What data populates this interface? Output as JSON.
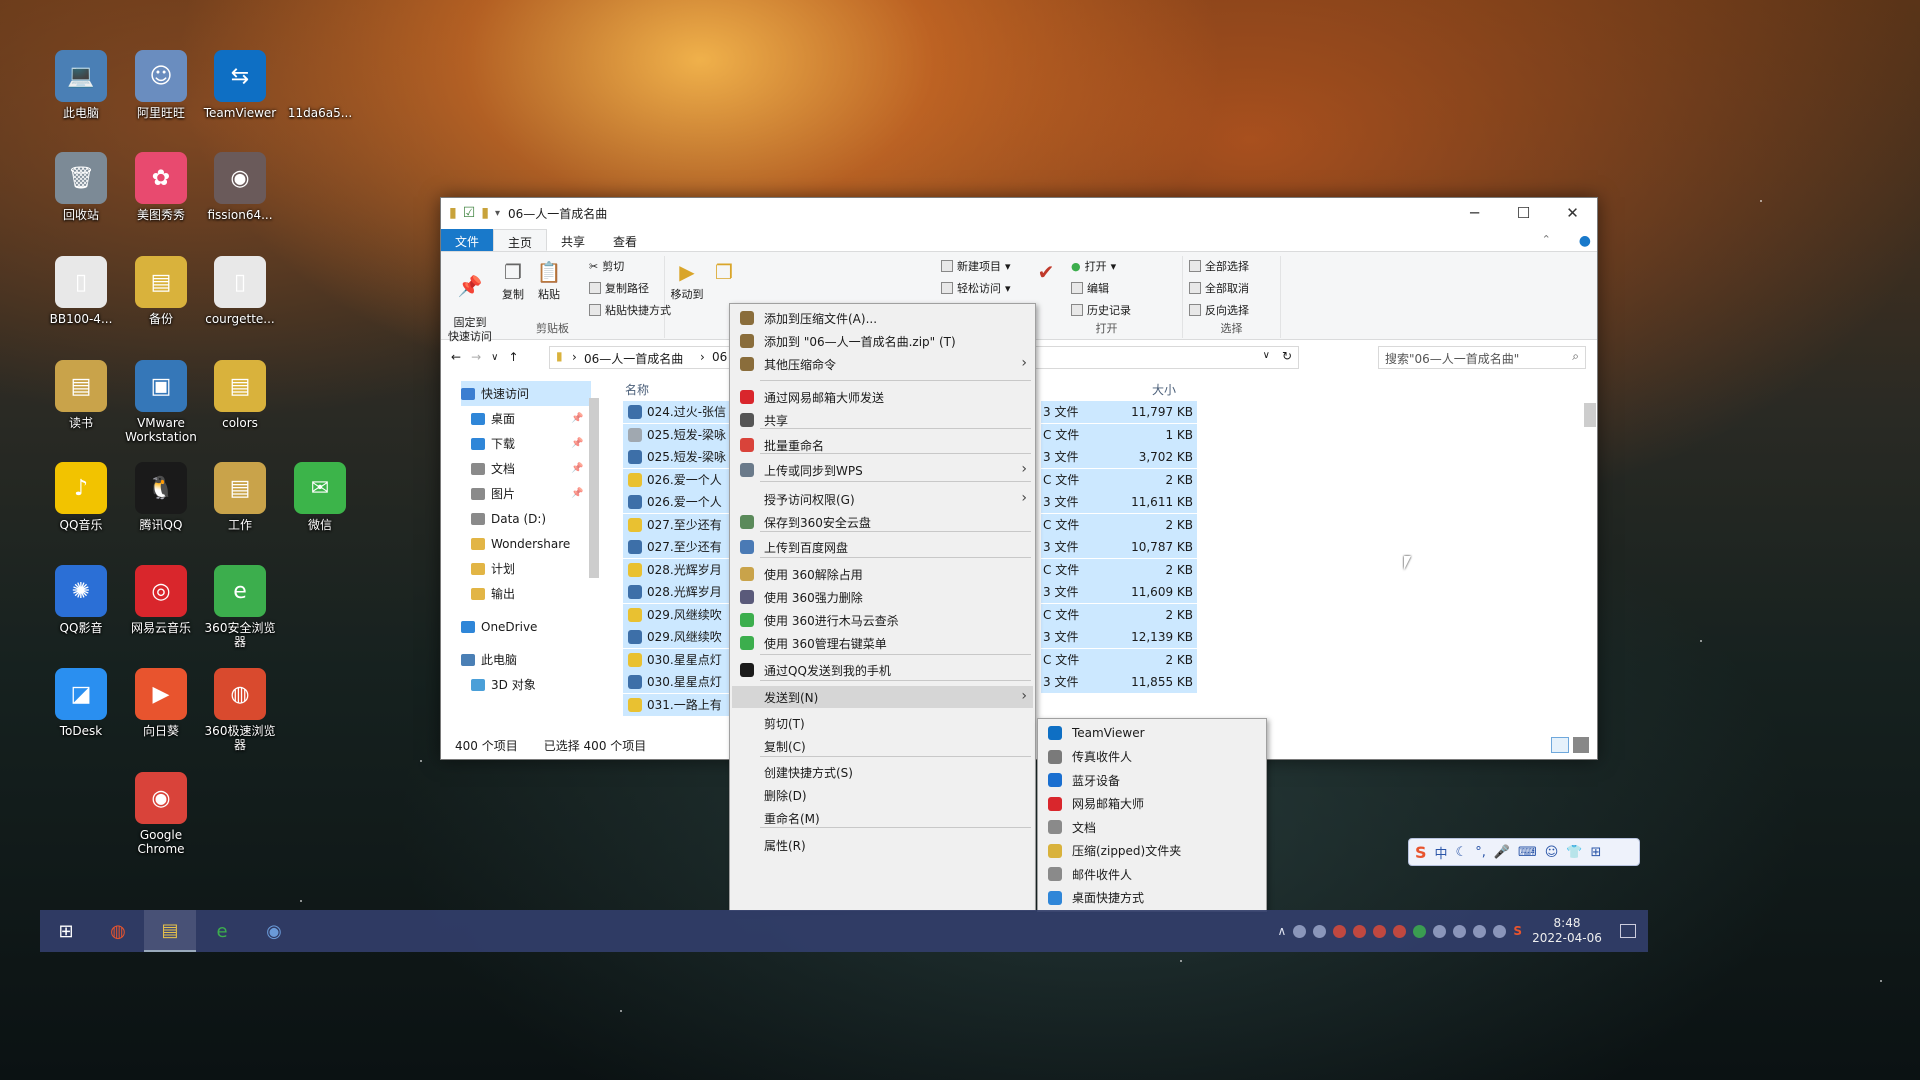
{
  "desktop": {
    "icons": [
      {
        "label": "此电脑",
        "glyph": "💻",
        "color": "#4a7fb5"
      },
      {
        "label": "阿里旺旺",
        "glyph": "☺",
        "color": "#6a8dbf"
      },
      {
        "label": "TeamViewer",
        "glyph": "⇆",
        "color": "#0e6fc4"
      },
      {
        "label": "11da6a5...",
        "glyph": "",
        "color": "transparent"
      },
      {
        "label": "回收站",
        "glyph": "🗑",
        "color": "#7c8a96"
      },
      {
        "label": "美图秀秀",
        "glyph": "✿",
        "color": "#e84a6f"
      },
      {
        "label": "fission64...",
        "glyph": "◉",
        "color": "#6a5a5a"
      },
      {
        "label": "BB100-4...",
        "glyph": "▯",
        "color": "#e8e8e8"
      },
      {
        "label": "备份",
        "glyph": "▤",
        "color": "#d9b23c"
      },
      {
        "label": "courgette...",
        "glyph": "▯",
        "color": "#e8e8e8"
      },
      {
        "label": "读书",
        "glyph": "▤",
        "color": "#c9a34a"
      },
      {
        "label": "VMware Workstation",
        "glyph": "▣",
        "color": "#3577b8"
      },
      {
        "label": "colors",
        "glyph": "▤",
        "color": "#d9b23c"
      },
      {
        "label": "QQ音乐",
        "glyph": "♪",
        "color": "#f2c300"
      },
      {
        "label": "腾讯QQ",
        "glyph": "🐧",
        "color": "#1a1a1a"
      },
      {
        "label": "工作",
        "glyph": "▤",
        "color": "#c9a34a"
      },
      {
        "label": "微信",
        "glyph": "✉",
        "color": "#3cb44a"
      },
      {
        "label": "QQ影音",
        "glyph": "✺",
        "color": "#2b6fd6"
      },
      {
        "label": "网易云音乐",
        "glyph": "◎",
        "color": "#d9262c"
      },
      {
        "label": "360安全浏览器",
        "glyph": "e",
        "color": "#3cae4d"
      },
      {
        "label": "ToDesk",
        "glyph": "◪",
        "color": "#2a8ff0"
      },
      {
        "label": "向日葵",
        "glyph": "▶",
        "color": "#e8542e"
      },
      {
        "label": "360极速浏览器",
        "glyph": "◍",
        "color": "#d94a2e"
      },
      {
        "label": "Google Chrome",
        "glyph": "◉",
        "color": "#d9433a"
      }
    ]
  },
  "explorer": {
    "title": "06—人一首成名曲",
    "tabs": [
      "文件",
      "主页",
      "共享",
      "查看"
    ],
    "ribbon": {
      "pin_label": "固定到\n快速访问",
      "copy_label": "复制",
      "paste_label": "粘贴",
      "cut_label": "剪切",
      "copy_path_label": "复制路径",
      "paste_shortcut_label": "粘贴快捷方式",
      "clipboard_group": "剪贴板",
      "move_label": "移动到",
      "new_item_label": "新建项目",
      "easy_access_label": "轻松访问",
      "open_label": "打开",
      "edit_label": "编辑",
      "history_label": "历史记录",
      "open_group": "打开",
      "select_all_label": "全部选择",
      "select_none_label": "全部取消",
      "invert_label": "反向选择",
      "select_group": "选择"
    },
    "address": {
      "path_root": "06—人一首成名曲",
      "path_next": "06",
      "search_placeholder": "搜索\"06—人一首成名曲\""
    },
    "nav": [
      {
        "label": "快速访问",
        "color": "#3b7ed1"
      },
      {
        "label": "桌面",
        "color": "#2f86d8"
      },
      {
        "label": "下载",
        "color": "#2f86d8"
      },
      {
        "label": "文档",
        "color": "#8a8a8a"
      },
      {
        "label": "图片",
        "color": "#8a8a8a"
      },
      {
        "label": "Data (D:)",
        "color": "#8a8a8a"
      },
      {
        "label": "Wondershare",
        "color": "#e2b545"
      },
      {
        "label": "计划",
        "color": "#e2b545"
      },
      {
        "label": "输出",
        "color": "#e2b545"
      },
      {
        "label": "OneDrive",
        "color": "#2f86d8"
      },
      {
        "label": "此电脑",
        "color": "#4a7fb5"
      },
      {
        "label": "3D 对象",
        "color": "#4a9fd8"
      }
    ],
    "columns": {
      "name": "名称",
      "size": "大小"
    },
    "files": [
      {
        "name": "024.过火-张信",
        "type": "3 文件",
        "size": "11,797 KB",
        "color": "#3d6fa8"
      },
      {
        "name": "025.短发-梁咏",
        "type": "C 文件",
        "size": "1 KB",
        "color": "#a0a8b0"
      },
      {
        "name": "025.短发-梁咏",
        "type": "3 文件",
        "size": "3,702 KB",
        "color": "#3d6fa8"
      },
      {
        "name": "026.爱一个人",
        "type": "C 文件",
        "size": "2 KB",
        "color": "#e9c131"
      },
      {
        "name": "026.爱一个人",
        "type": "3 文件",
        "size": "11,611 KB",
        "color": "#3d6fa8"
      },
      {
        "name": "027.至少还有",
        "type": "C 文件",
        "size": "2 KB",
        "color": "#e9c131"
      },
      {
        "name": "027.至少还有",
        "type": "3 文件",
        "size": "10,787 KB",
        "color": "#3d6fa8"
      },
      {
        "name": "028.光辉岁月",
        "type": "C 文件",
        "size": "2 KB",
        "color": "#e9c131"
      },
      {
        "name": "028.光辉岁月",
        "type": "3 文件",
        "size": "11,609 KB",
        "color": "#3d6fa8"
      },
      {
        "name": "029.风继续吹",
        "type": "C 文件",
        "size": "2 KB",
        "color": "#e9c131"
      },
      {
        "name": "029.风继续吹",
        "type": "3 文件",
        "size": "12,139 KB",
        "color": "#3d6fa8"
      },
      {
        "name": "030.星星点灯",
        "type": "C 文件",
        "size": "2 KB",
        "color": "#e9c131"
      },
      {
        "name": "030.星星点灯",
        "type": "3 文件",
        "size": "11,855 KB",
        "color": "#3d6fa8"
      },
      {
        "name": "031.一路上有",
        "type": "",
        "size": "",
        "color": "#e9c131"
      }
    ],
    "status_count": "400 个项目",
    "status_selected": "已选择 400 个项目"
  },
  "context_menu": {
    "items": [
      {
        "label": "添加到压缩文件(A)...",
        "color": "#8a6d3b",
        "sub": false
      },
      {
        "label": "添加到 \"06—人一首成名曲.zip\" (T)",
        "color": "#8a6d3b",
        "sub": false
      },
      {
        "label": "其他压缩命令",
        "color": "#8a6d3b",
        "sub": true
      },
      {
        "label": "通过网易邮箱大师发送",
        "color": "#d9262c",
        "sub": false
      },
      {
        "label": "共享",
        "color": "#555555",
        "sub": false
      },
      {
        "label": "批量重命名",
        "color": "#d9433a",
        "sub": false
      },
      {
        "label": "上传或同步到WPS",
        "color": "#6a7a8a",
        "sub": true
      },
      {
        "label": "授予访问权限(G)",
        "color": "transparent",
        "sub": true
      },
      {
        "label": "保存到360安全云盘",
        "color": "#5a8a5a",
        "sub": false
      },
      {
        "label": "上传到百度网盘",
        "color": "#4a7ab5",
        "sub": false
      },
      {
        "label": "使用 360解除占用",
        "color": "#c9a34a",
        "sub": false
      },
      {
        "label": "使用 360强力删除",
        "color": "#5a5a7a",
        "sub": false
      },
      {
        "label": "使用 360进行木马云查杀",
        "color": "#3cae4d",
        "sub": false
      },
      {
        "label": "使用 360管理右键菜单",
        "color": "#3cae4d",
        "sub": false
      },
      {
        "label": "通过QQ发送到我的手机",
        "color": "#1a1a1a",
        "sub": false
      },
      {
        "label": "发送到(N)",
        "color": "transparent",
        "sub": true
      },
      {
        "label": "剪切(T)",
        "color": "transparent",
        "sub": false
      },
      {
        "label": "复制(C)",
        "color": "transparent",
        "sub": false
      },
      {
        "label": "创建快捷方式(S)",
        "color": "transparent",
        "sub": false
      },
      {
        "label": "删除(D)",
        "color": "transparent",
        "sub": false
      },
      {
        "label": "重命名(M)",
        "color": "transparent",
        "sub": false
      },
      {
        "label": "属性(R)",
        "color": "transparent",
        "sub": false
      }
    ]
  },
  "sendto_menu": {
    "items": [
      {
        "label": "TeamViewer",
        "color": "#0e6fc4"
      },
      {
        "label": "传真收件人",
        "color": "#7a7a7a"
      },
      {
        "label": "蓝牙设备",
        "color": "#1a6fd0"
      },
      {
        "label": "网易邮箱大师",
        "color": "#d9262c"
      },
      {
        "label": "文档",
        "color": "#8a8a8a"
      },
      {
        "label": "压缩(zipped)文件夹",
        "color": "#d9b23c"
      },
      {
        "label": "邮件收件人",
        "color": "#8a8a8a"
      },
      {
        "label": "桌面快捷方式",
        "color": "#2f86d8"
      }
    ]
  },
  "taskbar": {
    "clock_time": "8:48",
    "clock_date": "2022-04-06"
  },
  "ime_toolbar": {
    "logo": "S",
    "mode": "中"
  },
  "colors": {
    "accent": "#1979ca",
    "selection": "#cce8ff",
    "taskbar": "#323e6a"
  }
}
